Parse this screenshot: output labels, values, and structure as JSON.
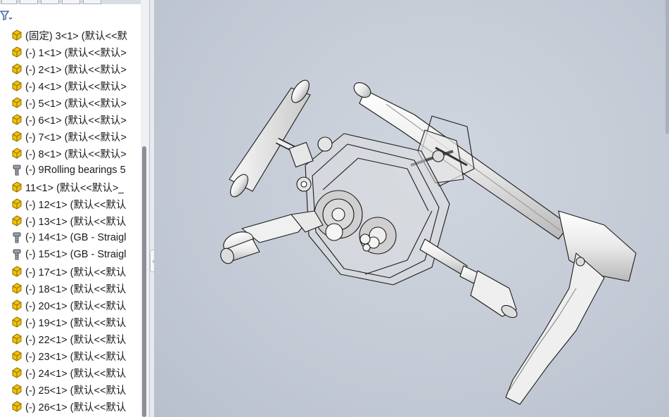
{
  "colors": {
    "assembly_icon": "#f2c200",
    "assembly_icon_outline": "#8a6a00",
    "fastener_icon": "#7a7f86",
    "panel_bg": "#ffffff",
    "viewport_bg": "#c2cad6"
  },
  "tree": {
    "filter_icon": "filter-icon",
    "items": [
      {
        "label": "(固定) 3<1> (默认<<默",
        "icon": "part-icon"
      },
      {
        "label": "(-) 1<1> (默认<<默认>",
        "icon": "part-icon"
      },
      {
        "label": "(-) 2<1> (默认<<默认>",
        "icon": "part-icon"
      },
      {
        "label": "(-) 4<1> (默认<<默认>",
        "icon": "part-icon"
      },
      {
        "label": "(-) 5<1> (默认<<默认>",
        "icon": "part-icon"
      },
      {
        "label": "(-) 6<1> (默认<<默认>",
        "icon": "part-icon"
      },
      {
        "label": "(-) 7<1> (默认<<默认>",
        "icon": "part-icon"
      },
      {
        "label": "(-) 8<1> (默认<<默认>",
        "icon": "part-icon"
      },
      {
        "label": "(-) 9Rolling bearings 5",
        "icon": "bolt-icon"
      },
      {
        "label": "11<1> (默认<<默认>_",
        "icon": "part-icon"
      },
      {
        "label": "(-) 12<1> (默认<<默认",
        "icon": "part-icon"
      },
      {
        "label": "(-) 13<1> (默认<<默认",
        "icon": "part-icon"
      },
      {
        "label": "(-) 14<1> (GB - Straigl",
        "icon": "bolt-icon"
      },
      {
        "label": "(-) 15<1> (GB - Straigl",
        "icon": "bolt-icon"
      },
      {
        "label": "(-) 17<1> (默认<<默认",
        "icon": "part-icon"
      },
      {
        "label": "(-) 18<1> (默认<<默认",
        "icon": "part-icon"
      },
      {
        "label": "(-) 20<1> (默认<<默认",
        "icon": "part-icon"
      },
      {
        "label": "(-) 19<1> (默认<<默认",
        "icon": "part-icon"
      },
      {
        "label": "(-) 22<1> (默认<<默认",
        "icon": "part-icon"
      },
      {
        "label": "(-) 23<1> (默认<<默认",
        "icon": "part-icon"
      },
      {
        "label": "(-) 24<1> (默认<<默认",
        "icon": "part-icon"
      },
      {
        "label": "(-) 25<1> (默认<<默认",
        "icon": "part-icon"
      },
      {
        "label": "(-) 26<1> (默认<<默认",
        "icon": "part-icon"
      }
    ]
  },
  "viewport": {
    "model": "drill-press-assembly"
  }
}
